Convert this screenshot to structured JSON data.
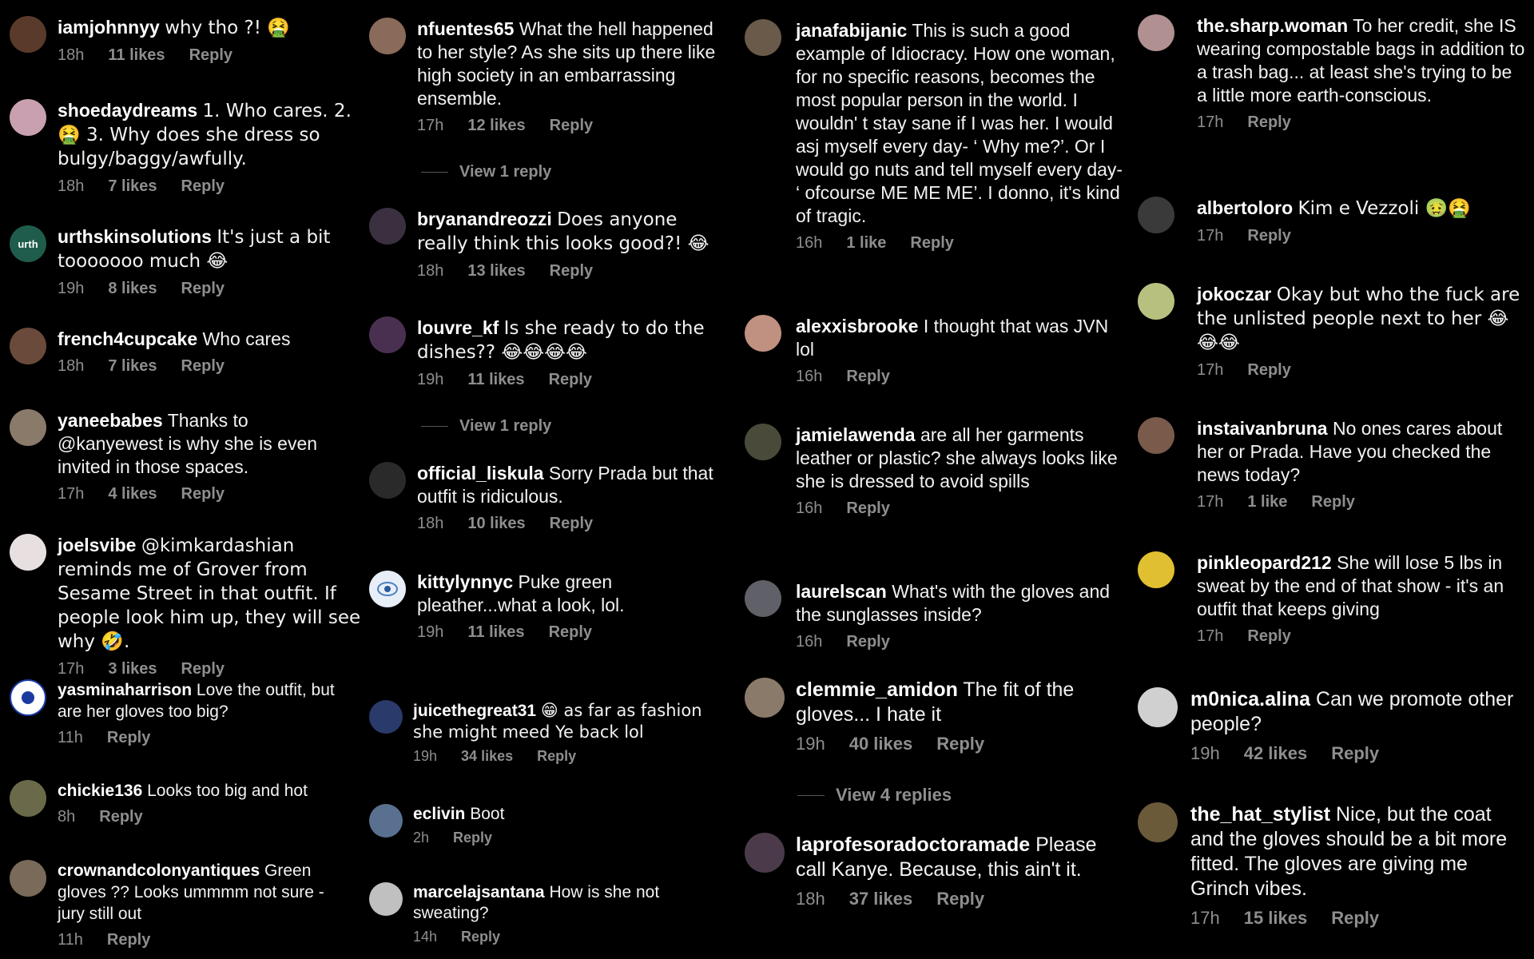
{
  "reply_label": "Reply",
  "columns": [
    {
      "comments": [
        {
          "user": "iamjohnnyy",
          "text": "why tho ?! 🤮",
          "time": "18h",
          "likes": "11 likes",
          "avatar_color": "#5a3a2a"
        },
        {
          "user": "shoedaydreams",
          "text": "1. Who cares. 2. 🤮 3. Why does she dress so bulgy/baggy/awfully.",
          "time": "18h",
          "likes": "7 likes",
          "avatar_color": "#c8a0b0"
        },
        {
          "user": "urthskinsolutions",
          "text": "It's just a bit tooooooo much 😂",
          "time": "19h",
          "likes": "8 likes",
          "avatar_color": "#1f5c4c",
          "avatar_text": "urth"
        },
        {
          "user": "french4cupcake",
          "text": "Who cares",
          "time": "18h",
          "likes": "7 likes",
          "avatar_color": "#6a4a3a"
        },
        {
          "user": "yaneebabes",
          "text": "Thanks to @kanyewest is why she is even invited in those spaces.",
          "time": "17h",
          "likes": "4 likes",
          "avatar_color": "#8a7a6a"
        },
        {
          "user": "joelsvibe",
          "text": "@kimkardashian reminds me of Grover from Sesame Street in that outfit. If people look him up, they will see why 🤣.",
          "time": "17h",
          "likes": "3 likes",
          "avatar_color": "#e8e0e0"
        },
        {
          "user": "yasminaharrison",
          "text": "Love the outfit, but are her gloves too big?",
          "time": "11h",
          "likes": "",
          "avatar_color": "#ffffff"
        },
        {
          "user": "chickie136",
          "text": "Looks too big and hot",
          "time": "8h",
          "likes": "",
          "avatar_color": "#6a6a4a"
        },
        {
          "user": "crownandcolonyantiques",
          "text": "Green gloves ?? Looks ummmm not sure - jury still out",
          "time": "11h",
          "likes": "",
          "avatar_color": "#7a6a5a"
        }
      ]
    },
    {
      "comments": [
        {
          "user": "nfuentes65",
          "text": "What the hell happened to her style? As she sits up there like high society in an embarrassing ensemble.",
          "time": "17h",
          "likes": "12 likes",
          "avatar_color": "#8a6a5a"
        },
        {
          "user": "bryanandreozzi",
          "text": "Does anyone really think this looks good?! 😂",
          "time": "18h",
          "likes": "13 likes",
          "avatar_color": "#3a3040"
        },
        {
          "user": "louvre_kf",
          "text": "Is she ready to do the dishes?? 😂😂😂😂",
          "time": "19h",
          "likes": "11 likes",
          "avatar_color": "#4a3050"
        },
        {
          "user": "official_liskula",
          "text": "Sorry Prada but that outfit is ridiculous.",
          "time": "18h",
          "likes": "10 likes",
          "avatar_color": "#2a2a2a"
        },
        {
          "user": "kittylynnyc",
          "text": "Puke green pleather...what a look, lol.",
          "time": "19h",
          "likes": "11 likes",
          "avatar_color": "#e8eef8"
        },
        {
          "user": "juicethegreat31",
          "text": "😁 as far as fashion she might meed Ye back lol",
          "time": "19h",
          "likes": "34 likes",
          "avatar_color": "#2a3a6a"
        },
        {
          "user": "eclivin",
          "text": "Boot",
          "time": "2h",
          "likes": "",
          "avatar_color": "#5a7090"
        },
        {
          "user": "marcelajsantana",
          "text": "How is she not sweating?",
          "time": "14h",
          "likes": "",
          "avatar_color": "#c0c0c0"
        }
      ],
      "view_replies": [
        "View 1 reply",
        "View 1 reply"
      ]
    },
    {
      "comments": [
        {
          "user": "janafabijanic",
          "text": "This is such a good example of Idiocracy. How one woman, for no specific reasons, becomes the most popular person in the world. I wouldn' t stay sane if I was her. I would asj myself every day- ‘ Why me?’. Or I would go nuts and tell myself every day- ‘ ofcourse ME ME ME’. I donno, it's kind of tragic.",
          "time": "16h",
          "likes": "1 like",
          "avatar_color": "#6a5a4a"
        },
        {
          "user": "alexxisbrooke",
          "text": "I thought that was JVN lol",
          "time": "16h",
          "likes": "",
          "avatar_color": "#c09080"
        },
        {
          "user": "jamielawenda",
          "text": "are all her garments leather or plastic? she always looks like she is dressed to avoid spills",
          "time": "16h",
          "likes": "",
          "avatar_color": "#4a4a3a"
        },
        {
          "user": "laurelscan",
          "text": "What's with the gloves and the sunglasses inside?",
          "time": "16h",
          "likes": "",
          "avatar_color": "#606068"
        },
        {
          "user": "clemmie_amidon",
          "text": "The fit of the gloves... I hate it",
          "time": "19h",
          "likes": "40 likes",
          "avatar_color": "#8a7a6a"
        },
        {
          "user": "laprofesoradoctoramade",
          "text": "Please call Kanye. Because, this ain't it.",
          "time": "18h",
          "likes": "37 likes",
          "avatar_color": "#4a3a4a"
        }
      ],
      "view_replies": [
        "View 4 replies"
      ]
    },
    {
      "comments": [
        {
          "user": "the.sharp.woman",
          "text": "To her credit, she IS wearing compostable bags in addition to a trash bag... at least she's trying to be a little more earth-conscious.",
          "time": "17h",
          "likes": "",
          "avatar_color": "#b09090"
        },
        {
          "user": "albertoloro",
          "text": "Kim e Vezzoli 🤢🤮",
          "time": "17h",
          "likes": "",
          "avatar_color": "#3a3a3a"
        },
        {
          "user": "jokoczar",
          "text": "Okay but who the fuck are the unlisted people next to her 😂😂😂",
          "time": "17h",
          "likes": "",
          "avatar_color": "#b8c080"
        },
        {
          "user": "instaivanbruna",
          "text": "No ones cares about her or Prada. Have you checked the news today?",
          "time": "17h",
          "likes": "1 like",
          "avatar_color": "#7a5a4a"
        },
        {
          "user": "pinkleopard212",
          "text": "She will lose 5 lbs in sweat by the end of that show - it's an outfit that keeps giving",
          "time": "17h",
          "likes": "",
          "avatar_color": "#e0c030"
        },
        {
          "user": "m0nica.alina",
          "text": "Can we promote other people?",
          "time": "19h",
          "likes": "42 likes",
          "avatar_color": "#d0d0d0"
        },
        {
          "user": "the_hat_stylist",
          "text": "Nice, but the coat and the gloves should be a bit more fitted.  The gloves are giving me Grinch vibes.",
          "time": "17h",
          "likes": "15 likes",
          "avatar_color": "#6a5a3a"
        }
      ]
    }
  ]
}
